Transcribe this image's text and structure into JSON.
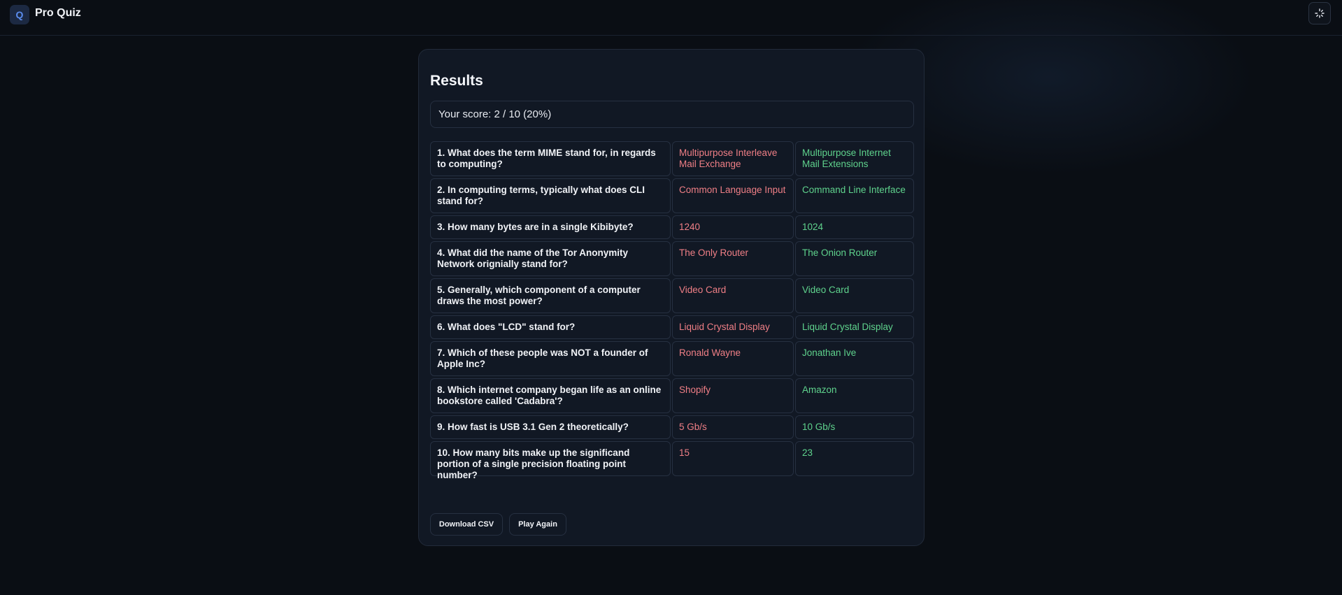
{
  "header": {
    "logo_letter": "Q",
    "app_title": "Pro Quiz"
  },
  "results": {
    "title": "Results",
    "score_text": "Your score: 2 / 10 (20%)",
    "rows": [
      {
        "question": "1. What does the term MIME stand for, in regards to computing?",
        "your_answer": "Multipurpose Interleave Mail Exchange",
        "correct_answer": "Multipurpose Internet Mail Extensions"
      },
      {
        "question": "2. In computing terms, typically what does CLI stand for?",
        "your_answer": "Common Language Input",
        "correct_answer": "Command Line Interface"
      },
      {
        "question": "3. How many bytes are in a single Kibibyte?",
        "your_answer": "1240",
        "correct_answer": "1024"
      },
      {
        "question": "4. What did the name of the Tor Anonymity Network orignially stand for?",
        "your_answer": "The Only Router",
        "correct_answer": "The Onion Router"
      },
      {
        "question": "5. Generally, which component of a computer draws the most power?",
        "your_answer": "Video Card",
        "correct_answer": "Video Card"
      },
      {
        "question": "6. What does \"LCD\" stand for?",
        "your_answer": "Liquid Crystal Display",
        "correct_answer": "Liquid Crystal Display"
      },
      {
        "question": "7. Which of these people was NOT a founder of Apple Inc?",
        "your_answer": "Ronald Wayne",
        "correct_answer": "Jonathan Ive"
      },
      {
        "question": "8. Which internet company began life as an online bookstore called 'Cadabra'?",
        "your_answer": "Shopify",
        "correct_answer": "Amazon"
      },
      {
        "question": "9. How fast is USB 3.1 Gen 2 theoretically?",
        "your_answer": "5 Gb/s",
        "correct_answer": "10 Gb/s"
      },
      {
        "question": "10. How many bits make up the significand portion of a single precision floating point number?",
        "your_answer": "15",
        "correct_answer": "23"
      }
    ],
    "download_label": "Download CSV",
    "play_again_label": "Play Again"
  },
  "colors": {
    "background": "#0a0e14",
    "card": "#111824",
    "wrong_answer": "#f07f86",
    "correct_answer": "#5fd38d",
    "accent": "#5b8def"
  },
  "icons": {
    "theme_toggle": "loader-sun-icon"
  }
}
